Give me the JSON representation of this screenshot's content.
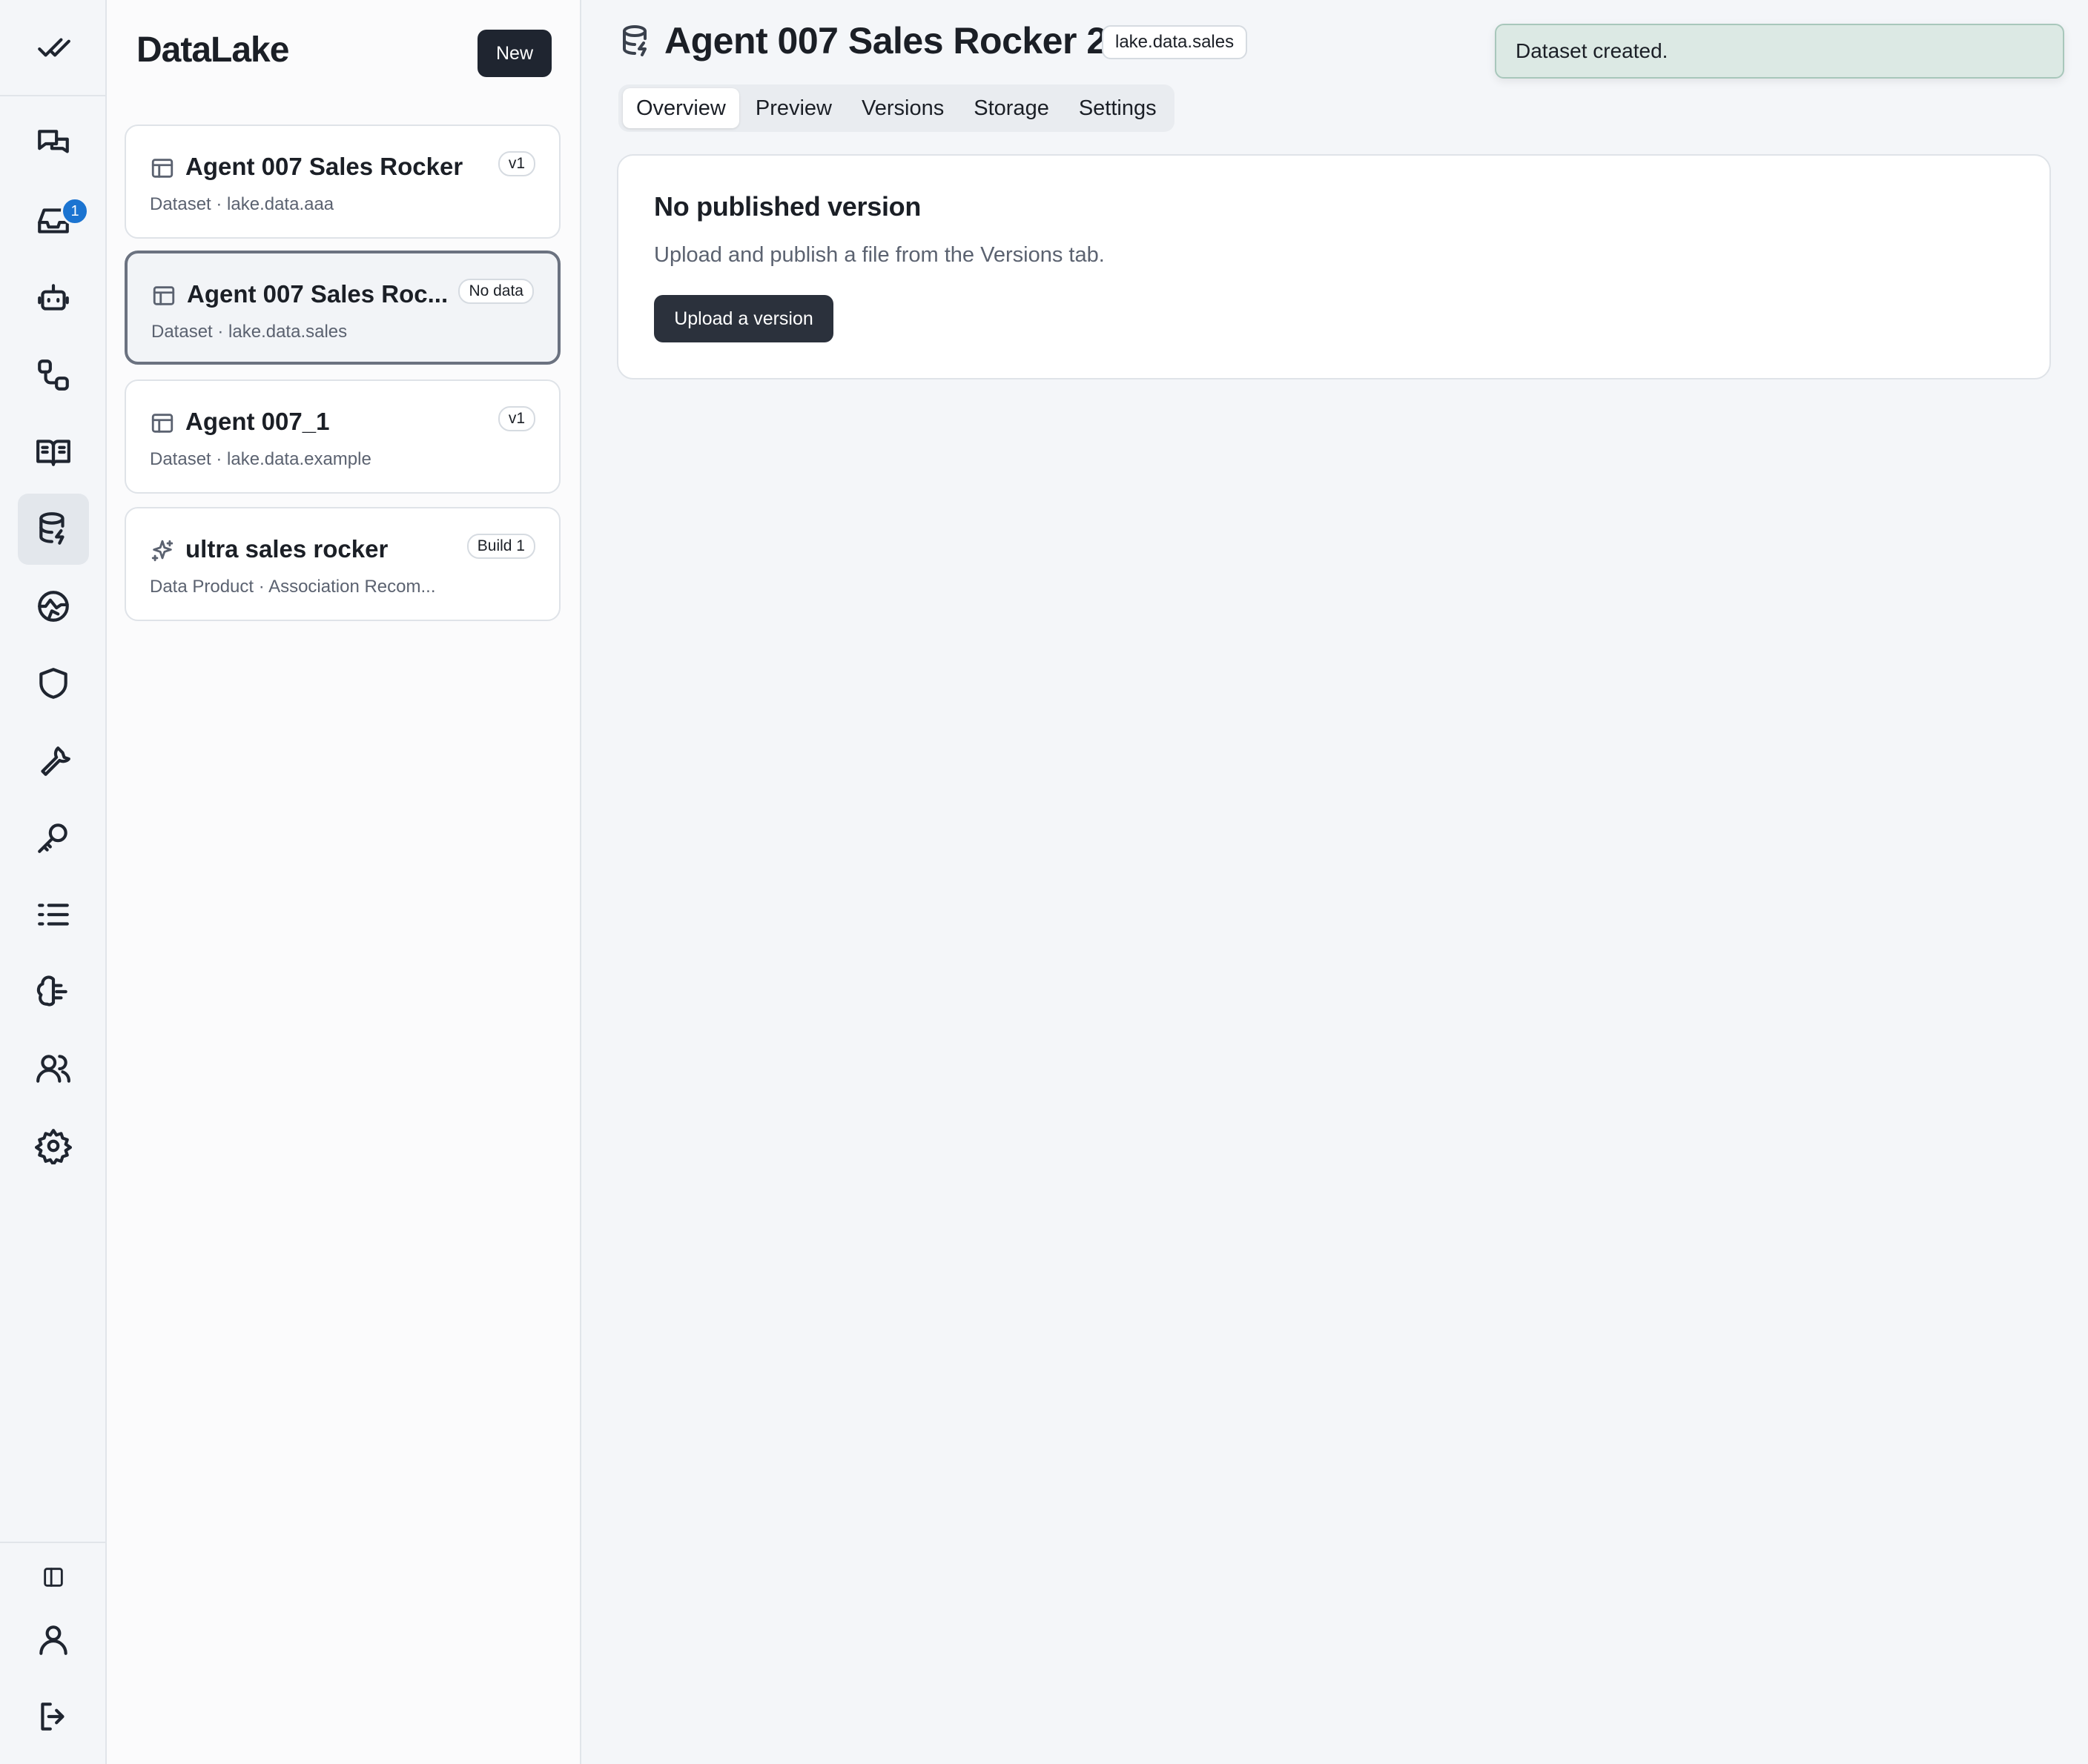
{
  "app": {
    "name": "DataLake",
    "new_label": "New"
  },
  "rail": {
    "items": [
      {
        "icon": "check-all-icon"
      },
      {
        "icon": "chat-icon"
      },
      {
        "icon": "inbox-icon",
        "badge": "1"
      },
      {
        "icon": "bot-icon"
      },
      {
        "icon": "workflow-icon"
      },
      {
        "icon": "book-icon"
      },
      {
        "icon": "database-icon",
        "active": true
      },
      {
        "icon": "globe-icon"
      },
      {
        "icon": "shield-icon"
      },
      {
        "icon": "wrench-icon"
      },
      {
        "icon": "key-icon"
      },
      {
        "icon": "list-icon"
      },
      {
        "icon": "brain-icon"
      },
      {
        "icon": "users-icon"
      },
      {
        "icon": "gear-icon"
      },
      {
        "icon": "sidebar-toggle-icon"
      },
      {
        "icon": "user-icon"
      },
      {
        "icon": "logout-icon"
      }
    ],
    "inbox_badge": "1"
  },
  "list": {
    "items": [
      {
        "title": "Agent 007 Sales Rocker",
        "subtitle": "Dataset · lake.data.aaa",
        "tag": "v1",
        "icon": "table-icon"
      },
      {
        "title": "Agent 007 Sales Roc...",
        "subtitle": "Dataset · lake.data.sales",
        "tag": "No data",
        "icon": "table-icon",
        "selected": true
      },
      {
        "title": "Agent 007_1",
        "subtitle": "Dataset · lake.data.example",
        "tag": "v1",
        "icon": "table-icon"
      },
      {
        "title": "ultra sales rocker",
        "subtitle": "Data Product · Association Recom...",
        "tag": "Build 1",
        "icon": "sparkle-icon"
      }
    ]
  },
  "header": {
    "title": "Agent 007 Sales Rocker 2",
    "tag": "lake.data.sales",
    "icon": "database-icon"
  },
  "tabs": [
    "Overview",
    "Preview",
    "Versions",
    "Storage",
    "Settings"
  ],
  "active_tab": "Overview",
  "empty_state": {
    "title": "No published version",
    "description": "Upload and publish a file from the Versions tab.",
    "button": "Upload a version"
  },
  "toast": {
    "message": "Dataset created."
  },
  "colors": {
    "accent": "#1f2530",
    "badge": "#1b74d1",
    "toast_bg": "#dce9e4"
  }
}
